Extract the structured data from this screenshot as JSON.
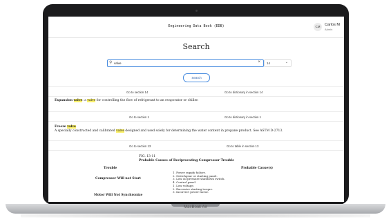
{
  "app": {
    "title": "Engineering Data Book (EDB)"
  },
  "user": {
    "initials": "CM",
    "name": "Carlos M",
    "role": "Admin"
  },
  "page": {
    "heading": "Search"
  },
  "search": {
    "value": "valve",
    "section_value": "14",
    "button_label": "Search"
  },
  "icons": {
    "search": "search-icon",
    "clear": "close-icon",
    "dropdown": "chevron-down-icon"
  },
  "results": [
    {
      "link_left": "Go to section 14",
      "link_right": "Go to dictionary in section 14",
      "term_prefix": "Expansion ",
      "term_highlight": "valve",
      "def_a": ": a ",
      "def_highlight": "valve",
      "def_b": " for controlling the flow of refrigerant to an evaporator or chiller."
    },
    {
      "link_left": "Go to section 1",
      "link_right": "Go to dictionary in section 1",
      "term_prefix": "Freeze ",
      "term_highlight": "valve",
      "def_a": "A specially constructed and calibrated ",
      "def_highlight": "valve",
      "def_b": " designed and used solely for determining the water content in propane product. See ASTM D-2713."
    },
    {
      "link_left": "Go to section 13",
      "link_right": "Go to table in section 13",
      "fig_label": "FIG. 13-11",
      "fig_title": "Probable Causes of Reciprocating Compressor Trouble",
      "col_trouble": "Trouble",
      "col_cause": "Probable Cause(s)",
      "rows": [
        {
          "trouble": "Compressor Will not Start",
          "causes": [
            "1. Power supply failure.",
            "2. Switchgear or starting panel.",
            "3. Low oil pressure shutdown switch.",
            "4. Control panel."
          ]
        },
        {
          "trouble": "Motor Will Not Synchronize",
          "causes": [
            "1. Low voltage.",
            "2. Excessive starting torque.",
            "3. Incorrect power factor."
          ]
        }
      ]
    }
  ],
  "device": {
    "label": "MacBook Air"
  }
}
